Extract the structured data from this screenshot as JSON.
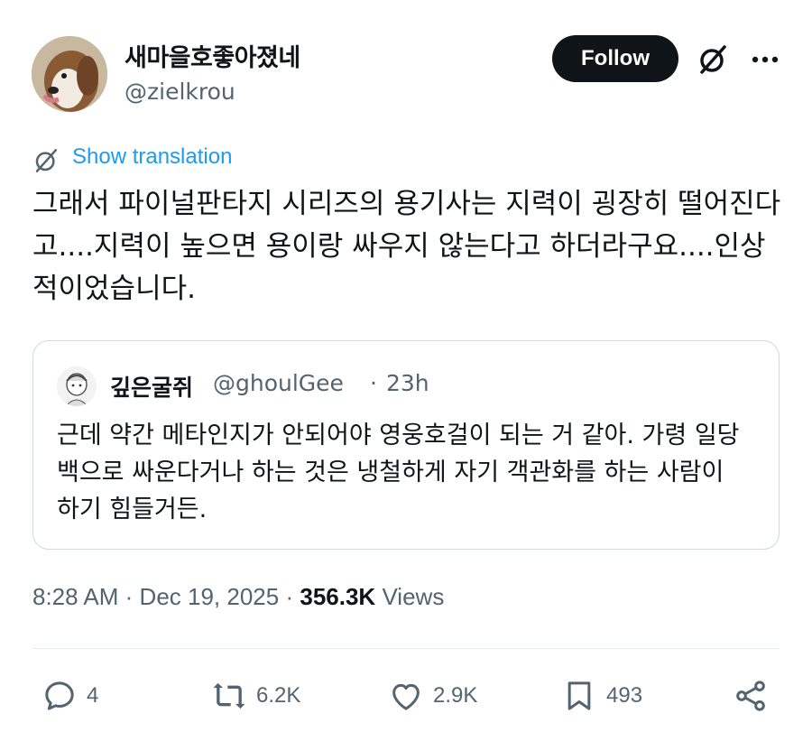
{
  "author": {
    "display_name": "새마을호좋아졌네",
    "handle": "@zielkrou",
    "follow_label": "Follow"
  },
  "translation": {
    "label": "Show translation"
  },
  "tweet": {
    "text": "그래서 파이널판타지 시리즈의 용기사는 지력이 굉장히 떨어진다고....지력이 높으면 용이랑 싸우지 않는다고 하더라구요....인상적이었습니다."
  },
  "quote": {
    "display_name": "깊은굴쥐",
    "handle": "@ghoulGee",
    "separator": "·",
    "time": "23h",
    "text": "근데 약간 메타인지가 안되어야 영웅호걸이 되는 거 같아. 가령 일당백으로 싸운다거나 하는 것은 냉철하게 자기 객관화를 하는 사람이 하기 힘들거든."
  },
  "meta": {
    "time": "8:28 AM",
    "sep1": "·",
    "date": "Dec 19, 2025",
    "sep2": "·",
    "views_count": "356.3K",
    "views_label": "Views"
  },
  "actions": {
    "replies": "4",
    "reposts": "6.2K",
    "likes": "2.9K",
    "bookmarks": "493"
  },
  "icons": [
    "grok-icon",
    "more-icon",
    "translate-icon",
    "reply-icon",
    "repost-icon",
    "like-icon",
    "bookmark-icon",
    "share-icon"
  ],
  "colors": {
    "accent": "#1d9bf0",
    "text": "#0f1419",
    "secondary": "#536471",
    "border": "#cfd9de"
  }
}
